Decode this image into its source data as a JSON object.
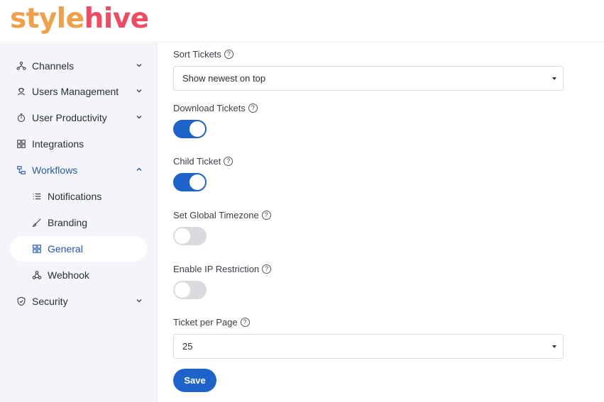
{
  "brand": {
    "part1": "style",
    "part2": "hive",
    "color1": "#f0a04b",
    "color2": "#ef4c63"
  },
  "sidebar": {
    "items": [
      {
        "label": "Channels",
        "icon": "channels-icon",
        "expandable": true
      },
      {
        "label": "Users Management",
        "icon": "users-icon",
        "expandable": true
      },
      {
        "label": "User Productivity",
        "icon": "stopwatch-icon",
        "expandable": true
      },
      {
        "label": "Integrations",
        "icon": "integrations-icon",
        "expandable": false
      },
      {
        "label": "Workflows",
        "icon": "workflows-icon",
        "expandable": true,
        "expanded": true
      },
      {
        "label": "Notifications",
        "icon": "list-icon",
        "sub": true
      },
      {
        "label": "Branding",
        "icon": "brush-icon",
        "sub": true
      },
      {
        "label": "General",
        "icon": "grid-icon",
        "sub": true,
        "active": true
      },
      {
        "label": "Webhook",
        "icon": "webhook-icon",
        "sub": true
      },
      {
        "label": "Security",
        "icon": "shield-icon",
        "expandable": true
      }
    ]
  },
  "settings": {
    "sort_tickets": {
      "label": "Sort Tickets",
      "value": "Show newest on top"
    },
    "download_tickets": {
      "label": "Download Tickets",
      "enabled": true
    },
    "child_ticket": {
      "label": "Child Ticket",
      "enabled": true
    },
    "global_timezone": {
      "label": "Set Global Timezone",
      "enabled": false
    },
    "ip_restriction": {
      "label": "Enable IP Restriction",
      "enabled": false
    },
    "ticket_per_page": {
      "label": "Ticket per Page",
      "value": "25"
    },
    "help_symbol": "?"
  },
  "actions": {
    "save_label": "Save"
  },
  "colors": {
    "accent": "#1e63c9",
    "sidebar_bg": "#f3f5f9",
    "toggle_off": "#d9dbde"
  }
}
